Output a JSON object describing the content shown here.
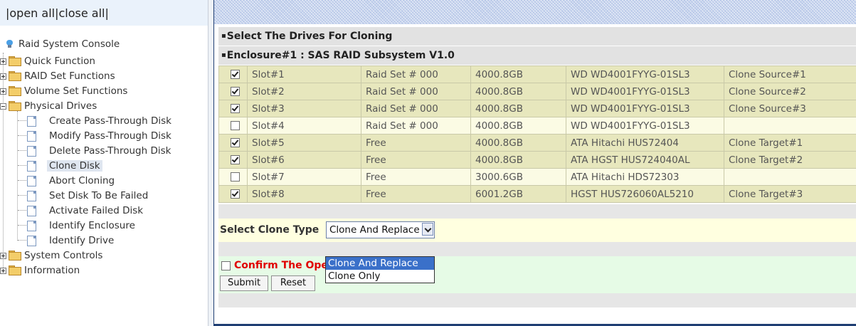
{
  "nav": {
    "open_all": "open all",
    "close_all": "close all",
    "sep": "|",
    "root": "Raid System Console",
    "items": [
      {
        "label": "Quick Function"
      },
      {
        "label": "RAID Set Functions"
      },
      {
        "label": "Volume Set Functions"
      },
      {
        "label": "Physical Drives"
      },
      {
        "label": "Create Pass-Through Disk"
      },
      {
        "label": "Modify Pass-Through Disk"
      },
      {
        "label": "Delete Pass-Through Disk"
      },
      {
        "label": "Clone Disk"
      },
      {
        "label": "Abort Cloning"
      },
      {
        "label": "Set Disk To Be Failed"
      },
      {
        "label": "Activate Failed Disk"
      },
      {
        "label": "Identify Enclosure"
      },
      {
        "label": "Identify Drive"
      },
      {
        "label": "System Controls"
      },
      {
        "label": "Information"
      }
    ]
  },
  "main": {
    "section_title": "Select The Drives For Cloning",
    "enclosure_title": "Enclosure#1 : SAS RAID Subsystem V1.0",
    "drives": [
      {
        "checked": true,
        "slot": "Slot#1",
        "raidset": "Raid Set # 000",
        "capacity": "4000.8GB",
        "model": "WD WD4001FYYG-01SL3",
        "role": "Clone Source#1"
      },
      {
        "checked": true,
        "slot": "Slot#2",
        "raidset": "Raid Set # 000",
        "capacity": "4000.8GB",
        "model": "WD WD4001FYYG-01SL3",
        "role": "Clone Source#2"
      },
      {
        "checked": true,
        "slot": "Slot#3",
        "raidset": "Raid Set # 000",
        "capacity": "4000.8GB",
        "model": "WD WD4001FYYG-01SL3",
        "role": "Clone Source#3"
      },
      {
        "checked": false,
        "slot": "Slot#4",
        "raidset": "Raid Set # 000",
        "capacity": "4000.8GB",
        "model": "WD WD4001FYYG-01SL3",
        "role": ""
      },
      {
        "checked": true,
        "slot": "Slot#5",
        "raidset": "Free",
        "capacity": "4000.8GB",
        "model": "ATA Hitachi HUS72404",
        "role": "Clone Target#1"
      },
      {
        "checked": true,
        "slot": "Slot#6",
        "raidset": "Free",
        "capacity": "4000.8GB",
        "model": "ATA HGST HUS724040AL",
        "role": "Clone Target#2"
      },
      {
        "checked": false,
        "slot": "Slot#7",
        "raidset": "Free",
        "capacity": "3000.6GB",
        "model": "ATA Hitachi HDS72303",
        "role": ""
      },
      {
        "checked": true,
        "slot": "Slot#8",
        "raidset": "Free",
        "capacity": "6001.2GB",
        "model": "HGST HUS726060AL5210",
        "role": "Clone Target#3"
      }
    ],
    "clone_type_label": "Select Clone Type",
    "clone_type_value": "Clone And Replace",
    "clone_type_options": [
      "Clone And Replace",
      "Clone Only"
    ],
    "confirm_label": "Confirm The Operation",
    "submit_label": "Submit",
    "reset_label": "Reset"
  }
}
